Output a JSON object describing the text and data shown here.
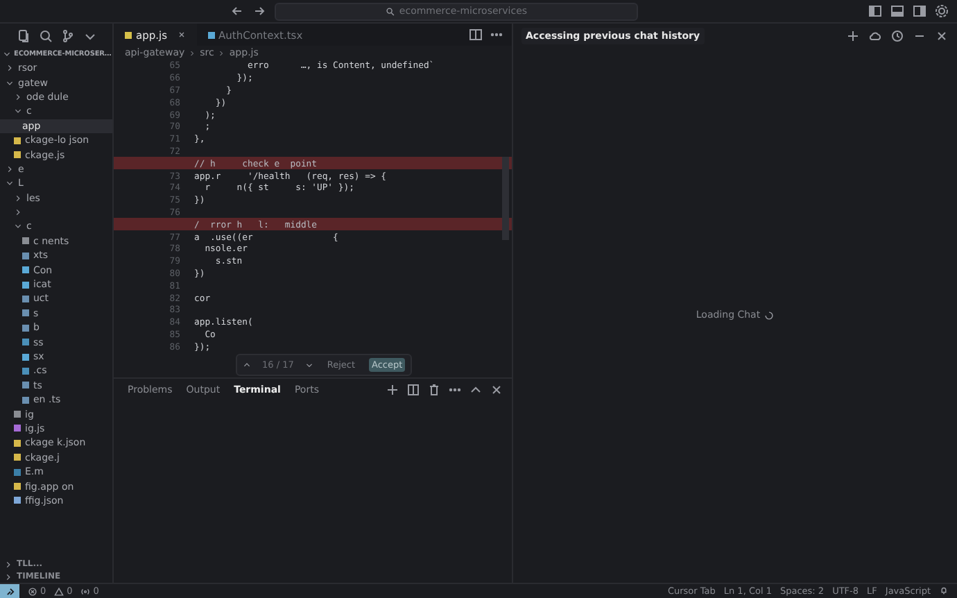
{
  "title_bar": {
    "search": "ecommerce-microservices"
  },
  "explorer": {
    "root": "ECOMMERCE-MICROSER…",
    "items": [
      {
        "label": "rsor",
        "expanded": false
      },
      {
        "label": "gatew",
        "expanded": true,
        "children": [
          {
            "label": "ode  dule",
            "expanded": false
          },
          {
            "label": "c",
            "expanded": true,
            "children": [
              {
                "label": "app",
                "selected": true
              }
            ]
          },
          {
            "label": "ckage-lo  json",
            "kind": "json"
          },
          {
            "label": "ckage.js",
            "kind": "json"
          }
        ]
      },
      {
        "label": "e",
        "expanded": false
      },
      {
        "label": "L",
        "expanded": true,
        "children": [
          {
            "label": "les",
            "expanded": false
          },
          {
            "expanded": false
          },
          {
            "label": "c",
            "expanded": true,
            "children": [
              {
                "label": "c   nents",
                "kind": "folder"
              },
              {
                "label": "xts",
                "kind": "file"
              },
              {
                "label": "Con",
                "kind": "react"
              },
              {
                "label": "icat",
                "kind": "react"
              },
              {
                "label": "uct",
                "kind": "file"
              },
              {
                "label": "s",
                "kind": "file"
              },
              {
                "label": "b",
                "kind": "file"
              },
              {
                "label": "ss",
                "kind": "css"
              },
              {
                "label": "sx",
                "kind": "react"
              },
              {
                "label": ".cs",
                "kind": "css"
              },
              {
                "label": "ts",
                "kind": "file"
              },
              {
                "label": "en   .ts",
                "kind": "file"
              }
            ]
          },
          {
            "label": "ig",
            "kind": "git"
          },
          {
            "label": "ig.js",
            "kind": "config"
          },
          {
            "label": "ckage   k.json",
            "kind": "json"
          },
          {
            "label": "ckage.j",
            "kind": "json"
          },
          {
            "label": "E.m",
            "kind": "md"
          },
          {
            "label": "fig.app   on",
            "kind": "json"
          },
          {
            "label": "ffig.json",
            "kind": "ts"
          }
        ]
      }
    ],
    "sections": [
      "TLL...",
      "TIMELINE"
    ]
  },
  "editor": {
    "tabs": [
      {
        "label": "app.js",
        "selected": true,
        "kind": "js"
      },
      {
        "label": "AuthContext.tsx",
        "selected": false,
        "kind": "react"
      }
    ],
    "breadcrumb": [
      "api-gateway",
      "src",
      "app.js"
    ],
    "lines": [
      {
        "number": "65",
        "text": "          erro      …, is Content, undefined`"
      },
      {
        "number": "66",
        "text": "        });"
      },
      {
        "number": "67",
        "text": "      }"
      },
      {
        "number": "68",
        "text": "    })"
      },
      {
        "number": "69",
        "text": "  );"
      },
      {
        "number": "70",
        "text": "  ;"
      },
      {
        "number": "71",
        "text": "},"
      },
      {
        "number": "72"
      },
      {
        "deleted": true,
        "text": "// h     check e  point"
      },
      {
        "number": "73",
        "text": "app.r     '/health   (req, res) => {"
      },
      {
        "number": "74",
        "text": "  r     n({ st     s: 'UP' });"
      },
      {
        "number": "75",
        "text": "})"
      },
      {
        "number": "76"
      },
      {
        "deleted": true,
        "text": "/  rror h   l:   middle"
      },
      {
        "number": "77",
        "text": "a  .use((er               {"
      },
      {
        "number": "78",
        "text": "  nsole.er"
      },
      {
        "number": "79",
        "text": "    s.stn"
      },
      {
        "number": "80",
        "text": "})"
      },
      {
        "number": "81"
      },
      {
        "number": "82",
        "text": "cor"
      },
      {
        "number": "83"
      },
      {
        "number": "84",
        "text": "app.listen("
      },
      {
        "number": "85",
        "text": "  Co"
      },
      {
        "number": "86",
        "text": "});"
      }
    ],
    "diff_widget": {
      "counter": "16 / 17",
      "reject": "Reject",
      "accept": "Accept"
    }
  },
  "panel": {
    "tabs": [
      {
        "label": "Problems",
        "selected": false
      },
      {
        "label": "Output",
        "selected": false
      },
      {
        "label": "Terminal",
        "selected": true
      },
      {
        "label": "Ports",
        "selected": false
      }
    ]
  },
  "chat": {
    "title": "Accessing previous chat history",
    "status": "Loading Chat"
  },
  "status_bar": {
    "errors": "0",
    "warnings": "0",
    "ports": "0",
    "right": [
      "Cursor Tab",
      "Ln 1, Col 1",
      "Spaces: 2",
      "UTF-8",
      "LF",
      "JavaScript"
    ]
  }
}
